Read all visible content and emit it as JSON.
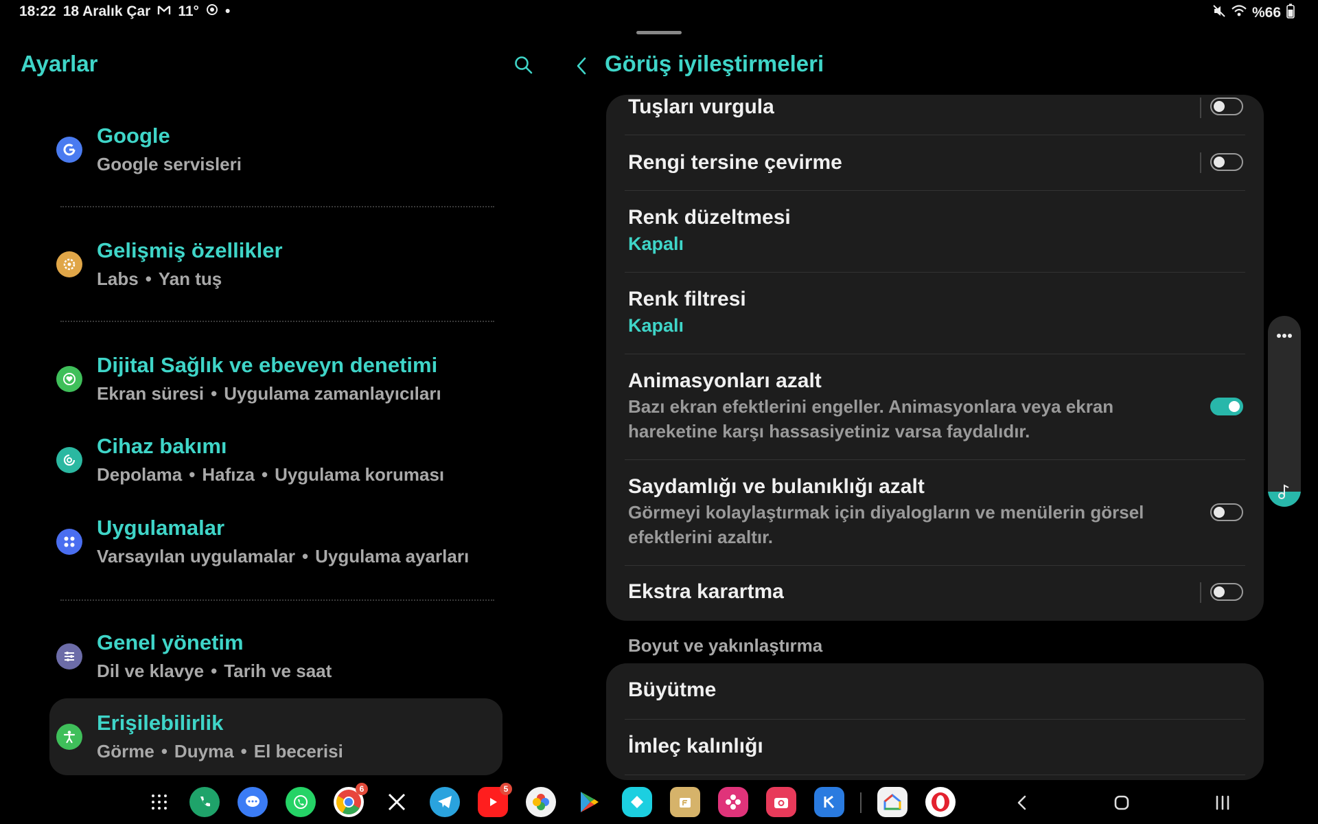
{
  "status_bar": {
    "time": "18:22",
    "date": "18 Aralık Çar",
    "weather": "11°",
    "battery": "%66"
  },
  "left_panel": {
    "title": "Ayarlar",
    "items": [
      {
        "title": "Google",
        "subtitle": [
          "Google servisleri"
        ],
        "icon": "google-icon",
        "icon_color": "#4a7bf0"
      },
      {
        "title": "Gelişmiş özellikler",
        "subtitle": [
          "Labs",
          "Yan tuş"
        ],
        "icon": "gear-star-icon",
        "icon_color": "#e0a648"
      },
      {
        "title": "Dijital Sağlık ve ebeveyn denetimi",
        "subtitle": [
          "Ekran süresi",
          "Uygulama zamanlayıcıları"
        ],
        "icon": "heart-circle-icon",
        "icon_color": "#3fbf5a"
      },
      {
        "title": "Cihaz bakımı",
        "subtitle": [
          "Depolama",
          "Hafıza",
          "Uygulama koruması"
        ],
        "icon": "device-care-icon",
        "icon_color": "#2bb8a1"
      },
      {
        "title": "Uygulamalar",
        "subtitle": [
          "Varsayılan uygulamalar",
          "Uygulama ayarları"
        ],
        "icon": "apps-grid-icon",
        "icon_color": "#4a6ef0"
      },
      {
        "title": "Genel yönetim",
        "subtitle": [
          "Dil ve klavye",
          "Tarih ve saat"
        ],
        "icon": "sliders-icon",
        "icon_color": "#6c6ca8"
      },
      {
        "title": "Erişilebilirlik",
        "subtitle": [
          "Görme",
          "Duyma",
          "El becerisi"
        ],
        "icon": "accessibility-icon",
        "icon_color": "#3fbf5a",
        "active": true
      }
    ]
  },
  "right_panel": {
    "title": "Görüş iyileştirmeleri",
    "rows": [
      {
        "title": "Tuşları vurgula",
        "toggle": false
      },
      {
        "title": "Rengi tersine çevirme",
        "toggle": false
      },
      {
        "title": "Renk düzeltmesi",
        "status": "Kapalı"
      },
      {
        "title": "Renk filtresi",
        "status": "Kapalı"
      },
      {
        "title": "Animasyonları azalt",
        "desc": "Bazı ekran efektlerini engeller. Animasyonlara veya ekran hareketine karşı hassasiyetiniz varsa faydalıdır.",
        "toggle": true
      },
      {
        "title": "Saydamlığı ve bulanıklığı azalt",
        "desc": "Görmeyi kolaylaştırmak için diyalogların ve menülerin görsel efektlerini azaltır.",
        "toggle": false
      },
      {
        "title": "Ekstra karartma",
        "toggle": false
      }
    ],
    "section_header": "Boyut ve yakınlaştırma",
    "rows2": [
      {
        "title": "Büyütme"
      },
      {
        "title": "İmleç kalınlığı"
      }
    ]
  },
  "taskbar": {
    "apps": [
      {
        "name": "all-apps",
        "glyph": "⋮⋮",
        "color": "#000"
      },
      {
        "name": "phone",
        "glyph": "✆",
        "color": "#1fa36a"
      },
      {
        "name": "messages",
        "glyph": "…",
        "color": "#3b7cf5"
      },
      {
        "name": "whatsapp",
        "glyph": "✆",
        "color": "#25d366"
      },
      {
        "name": "chrome",
        "glyph": "◎",
        "color": "#e8a33d",
        "badge": "6"
      },
      {
        "name": "x",
        "glyph": "𝕏",
        "color": "#000"
      },
      {
        "name": "telegram",
        "glyph": "➤",
        "color": "#2aa3de"
      },
      {
        "name": "youtube",
        "glyph": "▶",
        "color": "#ff1e1e",
        "badge": "5"
      },
      {
        "name": "photos",
        "glyph": "✿",
        "color": "#f2f2f2"
      },
      {
        "name": "play-store",
        "glyph": "▶",
        "color": "#34a0e0"
      },
      {
        "name": "app-teal",
        "glyph": "◆",
        "color": "#1ccfe0"
      },
      {
        "name": "files",
        "glyph": "F",
        "color": "#d6b36a"
      },
      {
        "name": "flower-app",
        "glyph": "✽",
        "color": "#e0337a"
      },
      {
        "name": "camera",
        "glyph": "◉",
        "color": "#e83a5a"
      },
      {
        "name": "k-app",
        "glyph": "K",
        "color": "#2a7be0"
      },
      {
        "name": "home-app",
        "glyph": "⌂",
        "color": "#f2f2f2"
      },
      {
        "name": "opera",
        "glyph": "O",
        "color": "#e3222f"
      }
    ]
  }
}
